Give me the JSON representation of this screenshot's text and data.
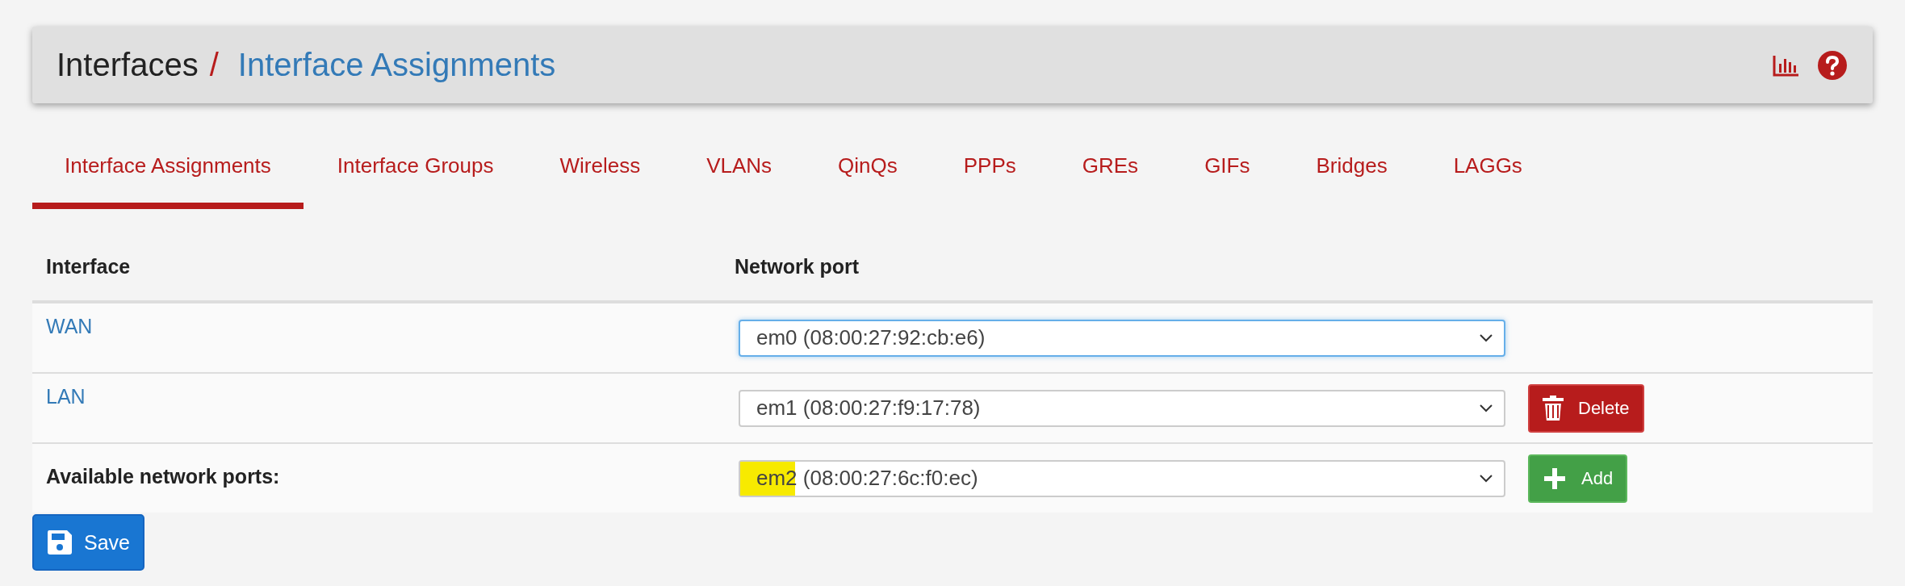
{
  "breadcrumb": {
    "section": "Interfaces",
    "separator": "/",
    "page": "Interface Assignments"
  },
  "tabs": [
    {
      "label": "Interface Assignments",
      "selected": true
    },
    {
      "label": "Interface Groups",
      "selected": false
    },
    {
      "label": "Wireless",
      "selected": false
    },
    {
      "label": "VLANs",
      "selected": false
    },
    {
      "label": "QinQs",
      "selected": false
    },
    {
      "label": "PPPs",
      "selected": false
    },
    {
      "label": "GREs",
      "selected": false
    },
    {
      "label": "GIFs",
      "selected": false
    },
    {
      "label": "Bridges",
      "selected": false
    },
    {
      "label": "LAGGs",
      "selected": false
    }
  ],
  "table": {
    "columns": [
      "Interface",
      "Network port"
    ],
    "rows": [
      {
        "kind": "link",
        "interface": "WAN",
        "port": "em0 (08:00:27:92:cb:e6)",
        "focused": true,
        "highlighted": false
      },
      {
        "kind": "link",
        "interface": "LAN",
        "port": "em1 (08:00:27:f9:17:78)",
        "focused": false,
        "highlighted": false,
        "action": {
          "kind": "delete",
          "label": "Delete"
        }
      },
      {
        "kind": "label",
        "interface": "Available network ports:",
        "port": "em2 (08:00:27:6c:f0:ec)",
        "focused": false,
        "highlighted": true,
        "action": {
          "kind": "add",
          "label": "Add"
        }
      }
    ]
  },
  "save_button": "Save"
}
